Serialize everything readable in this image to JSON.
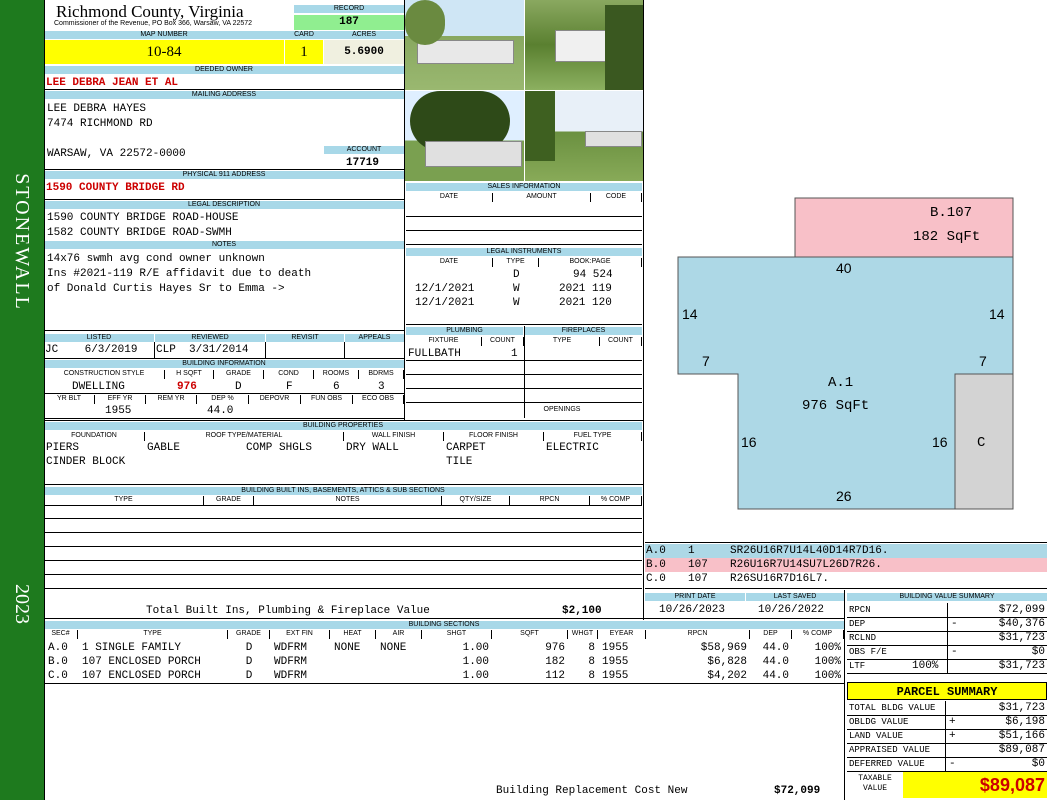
{
  "sidebar": {
    "district": "STONEWALL",
    "year": "2023",
    "color": "#1e7a1e"
  },
  "header": {
    "county": "Richmond County, Virginia",
    "address": "Commissioner of the Revenue, PO Box 366, Warsaw, VA 22572",
    "record_label": "RECORD",
    "record": "187",
    "map_label": "MAP NUMBER",
    "map": "10-84",
    "card_label": "CARD",
    "card": "1",
    "acres_label": "ACRES",
    "acres": "5.6900"
  },
  "owner": {
    "label": "DEEDED OWNER",
    "name": "LEE DEBRA JEAN ET AL",
    "mail_label": "MAILING ADDRESS",
    "mail_lines": [
      "LEE DEBRA HAYES",
      "7474 RICHMOND RD",
      "",
      "WARSAW, VA 22572-0000"
    ],
    "account_label": "ACCOUNT",
    "account": "17719",
    "phys_label": "PHYSICAL 911 ADDRESS",
    "phys": "1590 COUNTY BRIDGE RD",
    "legal_label": "LEGAL DESCRIPTION",
    "legal": [
      "1590 COUNTY BRIDGE ROAD-HOUSE",
      "1582 COUNTY BRIDGE ROAD-SWMH"
    ],
    "notes_label": "NOTES",
    "notes": [
      "14x76 swmh avg cond owner unknown",
      "Ins #2021-119 R/E affidavit due to death",
      "of Donald Curtis Hayes Sr to Emma ->"
    ]
  },
  "listing": {
    "h": [
      "LISTED",
      "REVIEWED",
      "REVISIT",
      "APPEALS"
    ],
    "listed": "JC    6/3/2019",
    "reviewed": "CLP  3/31/2014"
  },
  "building_info": {
    "label": "BUILDING INFORMATION",
    "h": [
      "CONSTRUCTION STYLE",
      "H SQFT",
      "GRADE",
      "COND",
      "ROOMS",
      "BDRMS"
    ],
    "style": "DWELLING",
    "hsqft": "976",
    "grade": "D",
    "cond": "F",
    "rooms": "6",
    "bdrms": "3",
    "h2": [
      "YR BLT",
      "EFF YR",
      "REM YR",
      "DEP %",
      "DEPOVR",
      "FUN OBS",
      "ECO OBS"
    ],
    "eff": "1955",
    "dep": "44.0"
  },
  "sales": {
    "label": "SALES INFORMATION",
    "h": [
      "DATE",
      "AMOUNT",
      "CODE"
    ]
  },
  "legal_inst": {
    "label": "LEGAL INSTRUMENTS",
    "h": [
      "DATE",
      "TYPE",
      "BOOK:PAGE"
    ],
    "rows": [
      {
        "d": "",
        "t": "D",
        "b": "94 524"
      },
      {
        "d": "12/1/2021",
        "t": "W",
        "b": "2021 119"
      },
      {
        "d": "12/1/2021",
        "t": "W",
        "b": "2021 120"
      }
    ]
  },
  "plumbing": {
    "label": "PLUMBING",
    "h": [
      "FIXTURE",
      "COUNT"
    ],
    "fixture": "FULLBATH",
    "count": "1"
  },
  "fireplaces": {
    "label": "FIREPLACES",
    "h": [
      "TYPE",
      "COUNT"
    ],
    "openings": "OPENINGS"
  },
  "props": {
    "label": "BUILDING PROPERTIES",
    "h": [
      "FOUNDATION",
      "ROOF TYPE/MATERIAL",
      "WALL FINISH",
      "FLOOR FINISH",
      "FUEL TYPE"
    ],
    "found": [
      "PIERS",
      "CINDER BLOCK"
    ],
    "roof_a": "GABLE",
    "roof_b": "COMP SHGLS",
    "wall": "DRY WALL",
    "floor": [
      "CARPET",
      "TILE"
    ],
    "fuel": "ELECTRIC"
  },
  "builtins": {
    "label": "BUILDING BUILT INS, BASEMENTS, ATTICS & SUB SECTIONS",
    "h": [
      "TYPE",
      "GRADE",
      "NOTES",
      "QTY/SIZE",
      "RPCN",
      "% COMP"
    ],
    "total_label": "Total Built Ins, Plumbing & Fireplace Value",
    "total": "$2,100"
  },
  "sections": {
    "label": "BUILDING SECTIONS",
    "h": [
      "SEC#",
      "TYPE",
      "GRADE",
      "EXT FIN",
      "HEAT",
      "AIR",
      "SHGT",
      "SQFT",
      "WHGT",
      "EYEAR",
      "RPCN",
      "DEP",
      "% COMP"
    ],
    "rows": [
      {
        "sec": "A.0",
        "type": "1 SINGLE FAMILY",
        "grade": "D",
        "ext": "WDFRM",
        "heat": "NONE",
        "air": "NONE",
        "shgt": "1.00",
        "sqft": "976",
        "whgt": "8",
        "year": "1955",
        "rpcn": "$58,969",
        "dep": "44.0",
        "comp": "100%"
      },
      {
        "sec": "B.0",
        "type": "107 ENCLOSED PORCH",
        "grade": "D",
        "ext": "WDFRM",
        "heat": "",
        "air": "",
        "shgt": "1.00",
        "sqft": "182",
        "whgt": "8",
        "year": "1955",
        "rpcn": "$6,828",
        "dep": "44.0",
        "comp": "100%"
      },
      {
        "sec": "C.0",
        "type": "107 ENCLOSED PORCH",
        "grade": "D",
        "ext": "WDFRM",
        "heat": "",
        "air": "",
        "shgt": "1.00",
        "sqft": "112",
        "whgt": "8",
        "year": "1955",
        "rpcn": "$4,202",
        "dep": "44.0",
        "comp": "100%"
      }
    ],
    "brcn_label": "Building Replacement Cost New",
    "brcn": "$72,099"
  },
  "sketch": {
    "b_label": "B.107",
    "b_area": "182 SqFt",
    "a_label": "A.1",
    "a_area": "976 SqFt",
    "c_label": "C",
    "d40": "40",
    "d14l": "14",
    "d14r": "14",
    "d7l": "7",
    "d7r": "7",
    "d16l": "16",
    "d16r": "16",
    "d26": "26",
    "pink": "#f8c0c8",
    "blue": "#add8e6",
    "grey": "#d3d3d3"
  },
  "sketch_codes": [
    {
      "id": "A.0",
      "n": "1",
      "code": "SR26U16R7U14L40D14R7D16."
    },
    {
      "id": "B.0",
      "n": "107",
      "code": "R26U16R7U14SU7L26D7R26."
    },
    {
      "id": "C.0",
      "n": "107",
      "code": "R26SU16R7D16L7."
    }
  ],
  "dates": {
    "print_label": "PRINT DATE",
    "print": "10/26/2023",
    "saved_label": "LAST SAVED",
    "saved": "10/26/2022"
  },
  "bvs": {
    "label": "BUILDING VALUE SUMMARY",
    "rows": [
      {
        "k": "RPCN",
        "s": "",
        "v": "$72,099"
      },
      {
        "k": "DEP",
        "s": "-",
        "v": "$40,376"
      },
      {
        "k": "RCLND",
        "s": "",
        "v": "$31,723"
      },
      {
        "k": "OBS F/E",
        "s": "-",
        "v": "$0"
      },
      {
        "k": "LTF",
        "p": "100%",
        "s": "",
        "v": "$31,723"
      }
    ]
  },
  "parcel": {
    "label": "PARCEL SUMMARY",
    "rows": [
      {
        "k": "TOTAL BLDG VALUE",
        "s": "",
        "v": "$31,723"
      },
      {
        "k": "OBLDG VALUE",
        "s": "+",
        "v": "$6,198"
      },
      {
        "k": "LAND VALUE",
        "s": "+",
        "v": "$51,166"
      },
      {
        "k": "APPRAISED VALUE",
        "s": "",
        "v": "$89,087"
      },
      {
        "k": "DEFERRED VALUE",
        "s": "-",
        "v": "$0"
      }
    ],
    "taxable_label": "TAXABLE VALUE",
    "taxable": "$89,087"
  }
}
